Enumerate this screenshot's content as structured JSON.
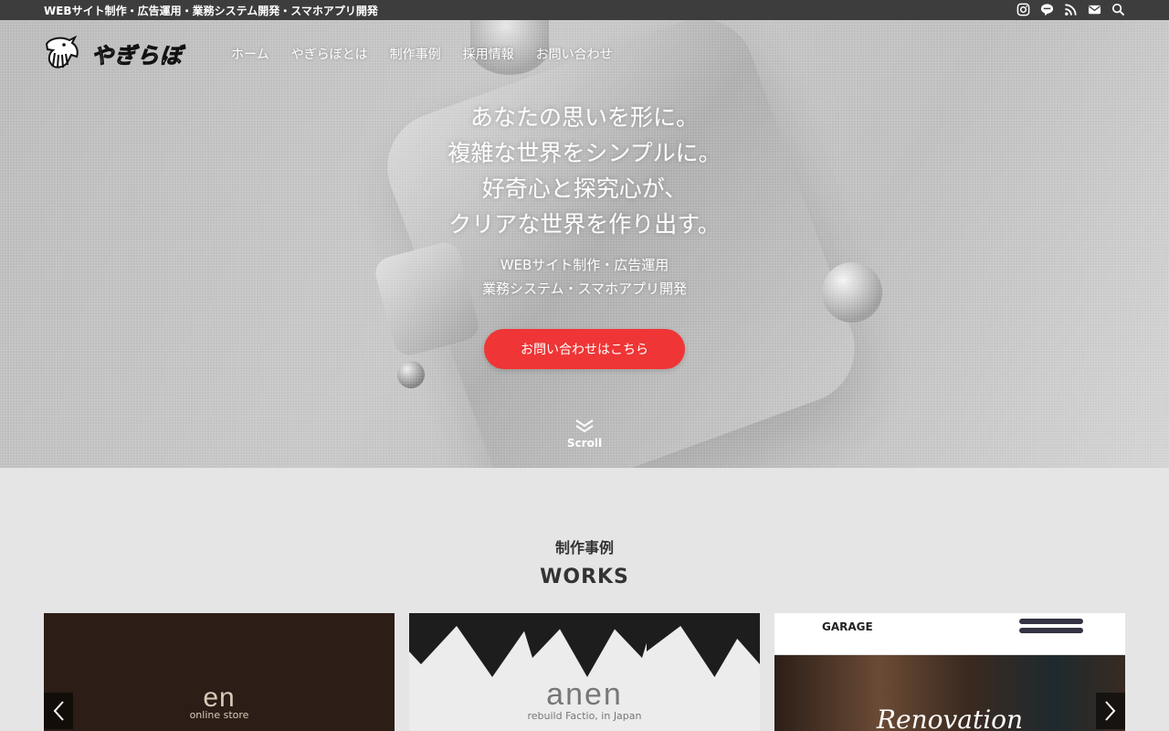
{
  "topbar": {
    "tagline": "WEBサイト制作・広告運用・業務システム開発・スマホアプリ開発",
    "icons": [
      "instagram-icon",
      "line-icon",
      "rss-icon",
      "mail-icon",
      "search-icon"
    ]
  },
  "header": {
    "logo_text": "やぎらぼ",
    "nav": [
      "ホーム",
      "やぎらぼとは",
      "制作事例",
      "採用情報",
      "お問い合わせ"
    ]
  },
  "hero": {
    "headline": [
      "あなたの思いを形に。",
      "複雑な世界をシンプルに。",
      "好奇心と探究心が、",
      "クリアな世界を作り出す。"
    ],
    "subline": [
      "WEBサイト制作・広告運用",
      "業務システム・スマホアプリ開発"
    ],
    "cta_label": "お問い合わせはこちら",
    "scroll_label": "Scroll"
  },
  "works": {
    "title_jp": "制作事例",
    "title_en": "WORKS",
    "cards": [
      {
        "brand": "en",
        "sub": "online store"
      },
      {
        "brand": "anen",
        "sub": "rebuild Factio, in Japan"
      },
      {
        "brand": "GARAGE",
        "photo_text": "Renovation"
      }
    ]
  },
  "colors": {
    "accent": "#ef3535",
    "topbar": "#3d3d3d",
    "section_bg": "#e5e5e5"
  }
}
